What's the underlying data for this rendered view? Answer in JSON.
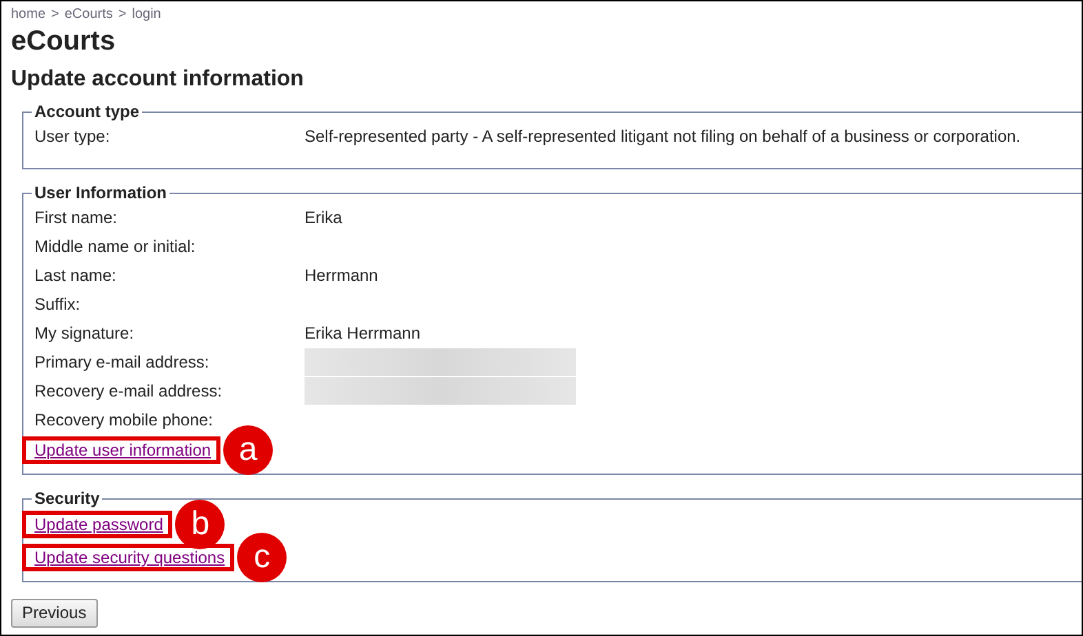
{
  "breadcrumb": [
    "home",
    "eCourts",
    "login"
  ],
  "breadcrumb_separator": ">",
  "site_title": "eCourts",
  "heading": "Update account information",
  "sections": [
    {
      "legend": "Account type",
      "rows": [
        {
          "label": "User type:",
          "value": "Self-represented party - A self-represented litigant not filing on behalf of a business or corporation."
        }
      ]
    },
    {
      "legend": "User Information",
      "rows": [
        {
          "label": "First name:",
          "value": "Erika"
        },
        {
          "label": "Middle name or initial:"
        },
        {
          "label": "Last name:",
          "value": "Herrmann"
        },
        {
          "label": "Suffix:"
        },
        {
          "label": "My signature:",
          "value": "Erika Herrmann"
        },
        {
          "label": "Primary e-mail address:",
          "redacted": true
        },
        {
          "label": "Recovery e-mail address:",
          "redacted": true
        },
        {
          "label": "Recovery mobile phone:"
        }
      ],
      "links": [
        {
          "text": "Update user information",
          "callout": "a"
        }
      ]
    },
    {
      "legend": "Security",
      "links": [
        {
          "text": "Update password",
          "callout": "b"
        },
        {
          "text": "Update security questions",
          "callout": "c"
        }
      ]
    }
  ],
  "previous_button": "Previous"
}
